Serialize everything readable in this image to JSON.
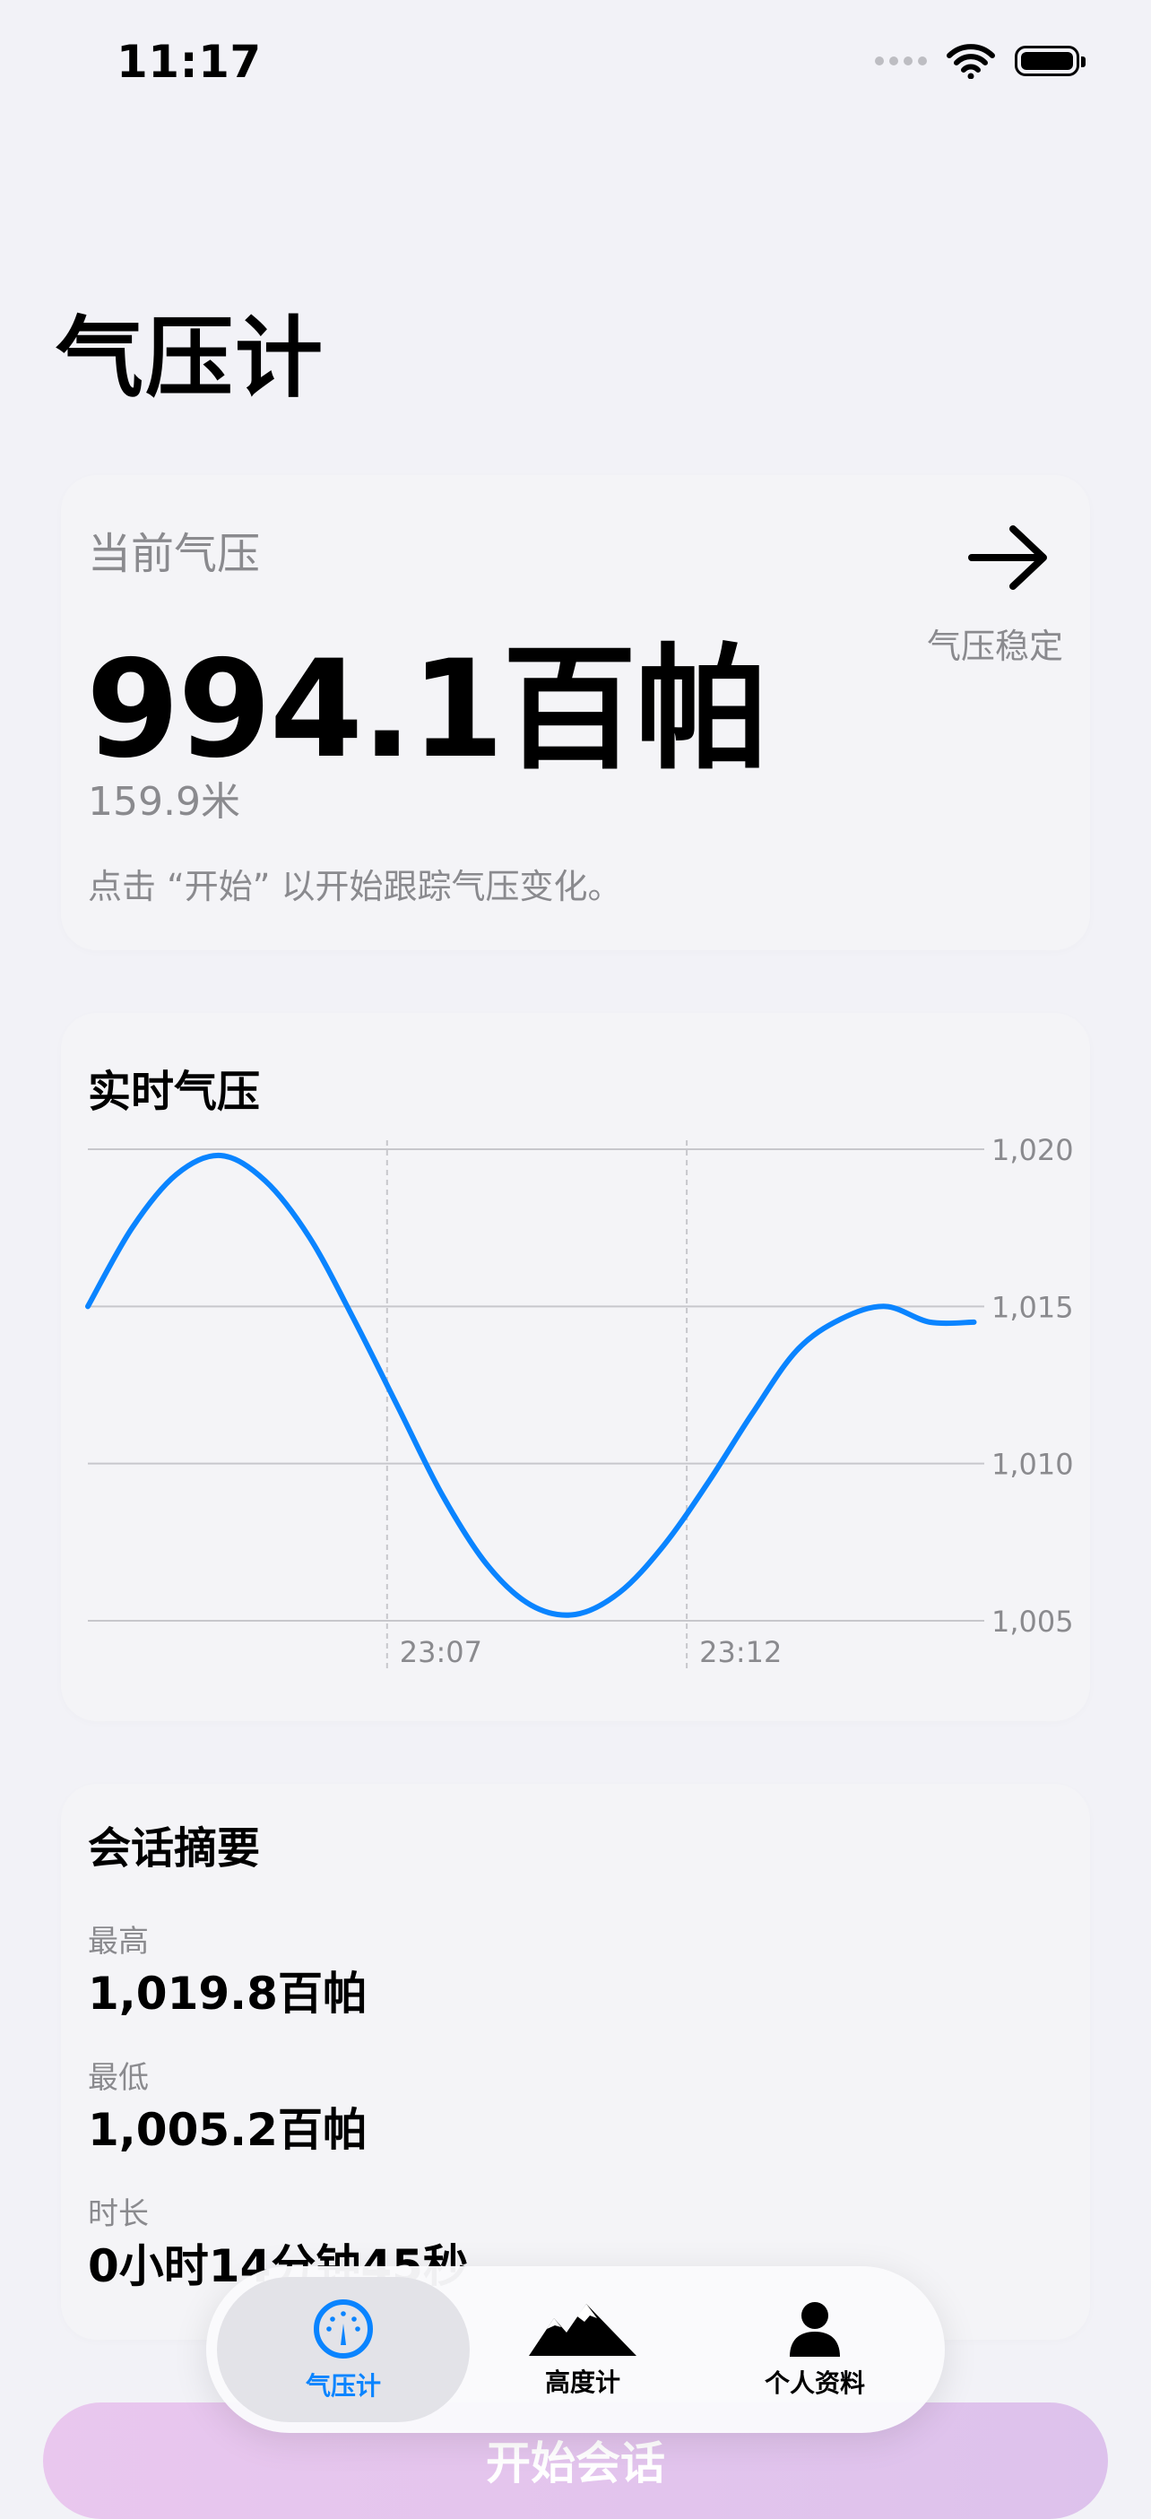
{
  "status_bar": {
    "time": "11:17"
  },
  "page": {
    "title": "气压计"
  },
  "current": {
    "label": "当前气压",
    "value": "994.1百帕",
    "altitude": "159.9米",
    "hint": "点击 “开始” 以开始跟踪气压变化。",
    "trend_label": "气压稳定",
    "trend_icon": "arrow-right-icon"
  },
  "realtime": {
    "title": "实时气压"
  },
  "chart_data": {
    "type": "line",
    "title": "实时气压",
    "xlabel": "",
    "ylabel": "",
    "x_ticks": [
      "23:07",
      "23:12"
    ],
    "y_ticks": [
      "1,020",
      "1,015",
      "1,010",
      "1,005"
    ],
    "ylim": [
      1005,
      1020
    ],
    "grid": true,
    "series": [
      {
        "color": "#0a84ff",
        "x": [
          0,
          1,
          2,
          3,
          4,
          5,
          6,
          7,
          8,
          9,
          10,
          11,
          12,
          13,
          14,
          15,
          16,
          17,
          18,
          19,
          20
        ],
        "y": [
          1015.0,
          1017.5,
          1019.2,
          1019.8,
          1019.0,
          1017.2,
          1014.6,
          1011.8,
          1009.0,
          1006.8,
          1005.5,
          1005.2,
          1005.9,
          1007.4,
          1009.4,
          1011.6,
          1013.6,
          1014.6,
          1015.0,
          1014.5,
          1014.5
        ]
      }
    ]
  },
  "summary": {
    "title": "会话摘要",
    "max_label": "最高",
    "max_value": "1,019.8百帕",
    "min_label": "最低",
    "min_value": "1,005.2百帕",
    "duration_label": "时长",
    "duration_value": "0小时14分钟45秒"
  },
  "start_button": {
    "label": "开始会话"
  },
  "tabs": [
    {
      "label": "气压计",
      "icon": "gauge-icon",
      "active": true
    },
    {
      "label": "高度计",
      "icon": "mountain-icon",
      "active": false
    },
    {
      "label": "个人资料",
      "icon": "person-icon",
      "active": false
    }
  ],
  "colors": {
    "accent": "#0a84ff",
    "start_button": "#e4c4ee"
  }
}
